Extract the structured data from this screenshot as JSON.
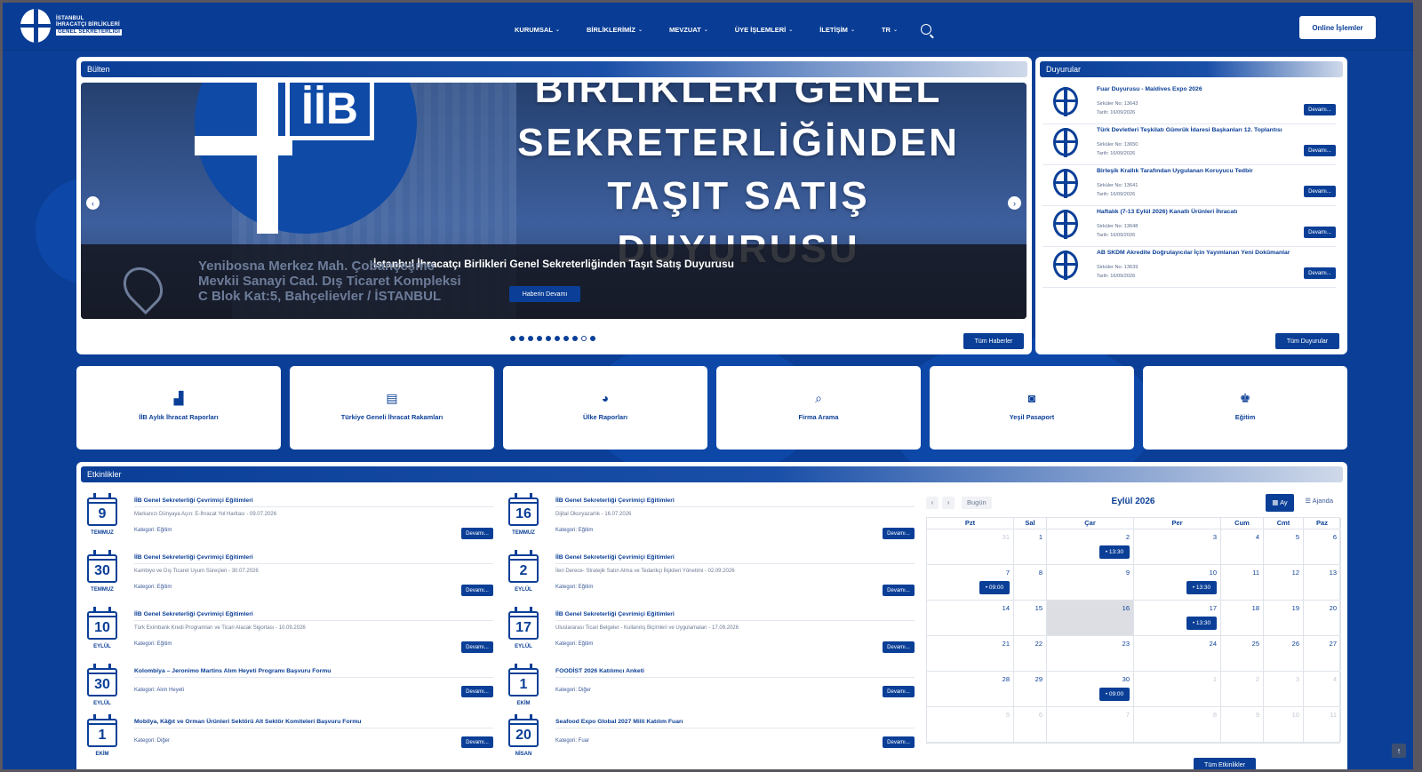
{
  "header": {
    "logo_lines": [
      "İSTANBUL",
      "İHRACATÇI BİRLİKLERİ",
      "GENEL SEKRETERLİĞİ"
    ],
    "nav": [
      {
        "label": "KURUMSAL"
      },
      {
        "label": "BİRLİKLERİMİZ"
      },
      {
        "label": "MEVZUAT"
      },
      {
        "label": "ÜYE İŞLEMLERİ"
      },
      {
        "label": "İLETİŞİM"
      },
      {
        "label": "TR"
      }
    ],
    "chevron": "⌄",
    "online_button": "Online İşlemler"
  },
  "bulten": {
    "title": "Bülten",
    "slide_text_lines": [
      "BİRLİKLERİ GENEL",
      "SEKRETERLİĞİNDEN",
      "TAŞIT SATIŞ",
      "DUYURUSU"
    ],
    "slide_logo": "İİB",
    "slide_address_lines": [
      "Yenibosna Merkez Mah. Çobançeşme",
      "Mevkii Sanayi Cad. Dış Ticaret Kompleksi",
      "C Blok Kat:5, Bahçelievler / İSTANBUL"
    ],
    "caption": "İstanbul İhracatçı Birlikleri Genel Sekreterliğinden Taşıt Satış Duyurusu",
    "caption_button": "Haberin Devamı",
    "all_button": "Tüm Haberler",
    "dots_total": 10,
    "dots_active_index": 8,
    "prev_arrow": "‹",
    "next_arrow": "›"
  },
  "duyurular": {
    "title": "Duyurular",
    "items": [
      {
        "title": "Fuar Duyurusu - Maldives Expo 2026",
        "no": "Sirküler No: 13643",
        "date": "Tarih: 16/09/2026",
        "button": "Devamı..."
      },
      {
        "title": "Türk Devletleri Teşkilatı Gümrük İdaresi Başkanları 12. Toplantısı",
        "no": "Sirküler No: 13650",
        "date": "Tarih: 16/09/2026",
        "button": "Devamı..."
      },
      {
        "title": "Birleşik Krallık Tarafından Uygulanan Koruyucu Tedbir",
        "no": "Sirküler No: 13641",
        "date": "Tarih: 16/09/2026",
        "button": "Devamı..."
      },
      {
        "title": "Haftalık (7-13 Eylül 2026) Kanatlı Ürünleri İhracatı",
        "no": "Sirküler No: 13648",
        "date": "Tarih: 16/09/2026",
        "button": "Devamı..."
      },
      {
        "title": "AB SKDM Akredite Doğrulayıcılar İçin Yayımlanan Yeni Dokümanlar",
        "no": "Sirküler No: 13639",
        "date": "Tarih: 16/09/2026",
        "button": "Devamı..."
      }
    ],
    "all_button": "Tüm Duyurular"
  },
  "tiles": [
    {
      "icon": "▟",
      "label": "İİB Aylık İhracat Raporları"
    },
    {
      "icon": "▤",
      "label": "Türkiye Geneli İhracat Rakamları"
    },
    {
      "icon": "◕",
      "label": "Ülke Raporları"
    },
    {
      "icon": "⌕",
      "label": "Firma Arama"
    },
    {
      "icon": "◙",
      "label": "Yeşil Pasaport"
    },
    {
      "icon": "♚",
      "label": "Eğitim"
    }
  ],
  "etkinlikler": {
    "title": "Etkinlikler",
    "left": [
      {
        "day": "9",
        "month": "TEMMUZ",
        "title": "İİB Genel Sekreterliği Çevrimiçi Eğitimleri",
        "sub": "Markanızı Dünyaya Açın: E-İhracat Yol Haritası - 09.07.2026",
        "cat": "Kategori: Eğitim",
        "button": "Devamı..."
      },
      {
        "day": "30",
        "month": "TEMMUZ",
        "title": "İİB Genel Sekreterliği Çevrimiçi Eğitimleri",
        "sub": "Kambiyo ve Dış Ticaret Uyum Süreçleri - 30.07.2026",
        "cat": "Kategori: Eğitim",
        "button": "Devamı..."
      },
      {
        "day": "10",
        "month": "EYLÜL",
        "title": "İİB Genel Sekreterliği Çevrimiçi Eğitimleri",
        "sub": "Türk Eximbank Kredi Programları ve Ticari Alacak Sigortası - 10.09.2026",
        "cat": "Kategori: Eğitim",
        "button": "Devamı..."
      },
      {
        "day": "30",
        "month": "EYLÜL",
        "title": "Kolombiya – Jeronimo Martins Alım Heyeti Programı Başvuru Formu",
        "sub": "",
        "cat": "Kategori: Alım Heyeti",
        "button": "Devamı..."
      },
      {
        "day": "1",
        "month": "EKİM",
        "title": "Mobilya, Kâğıt ve Orman Ürünleri Sektörü Alt Sektör Komiteleri Başvuru Formu",
        "sub": "",
        "cat": "Kategori: Diğer",
        "button": "Devamı..."
      }
    ],
    "right": [
      {
        "day": "16",
        "month": "TEMMUZ",
        "title": "İİB Genel Sekreterliği Çevrimiçi Eğitimleri",
        "sub": "Dijital Okuryazarlık - 16.07.2026",
        "cat": "Kategori: Eğitim",
        "button": "Devamı..."
      },
      {
        "day": "2",
        "month": "EYLÜL",
        "title": "İİB Genel Sekreterliği Çevrimiçi Eğitimleri",
        "sub": "İleri Derece- Stratejik Satın Alma ve Tedarikçi İlişkileri Yönetimi - 02.09.2026",
        "cat": "Kategori: Eğitim",
        "button": "Devamı..."
      },
      {
        "day": "17",
        "month": "EYLÜL",
        "title": "İİB Genel Sekreterliği Çevrimiçi Eğitimleri",
        "sub": "Uluslararası Ticari Belgeler - Kullanılış Biçimleri ve Uygulamaları - 17.09.2026",
        "cat": "Kategori: Eğitim",
        "button": "Devamı..."
      },
      {
        "day": "1",
        "month": "EKİM",
        "title": "FOODİST 2026 Katılımcı Anketi",
        "sub": "",
        "cat": "Kategori: Diğer",
        "button": "Devamı..."
      },
      {
        "day": "20",
        "month": "NİSAN",
        "title": "Seafood Expo Global 2027 Milli Katılım Fuarı",
        "sub": "",
        "cat": "Kategori: Fuar",
        "button": "Devamı..."
      }
    ],
    "all_button": "Tüm Etkinlikler"
  },
  "calendar": {
    "prev": "‹",
    "next": "›",
    "today_button": "Bugün",
    "title": "Eylül 2026",
    "view_month": "Ay",
    "view_agenda": "Ajanda",
    "weekdays": [
      "Pzt",
      "Sal",
      "Çar",
      "Per",
      "Cum",
      "Cmt",
      "Paz"
    ],
    "weeks": [
      [
        {
          "n": "31",
          "muted": true
        },
        {
          "n": "1"
        },
        {
          "n": "2",
          "event": "• 13:30"
        },
        {
          "n": "3"
        },
        {
          "n": "4"
        },
        {
          "n": "5"
        },
        {
          "n": "6"
        }
      ],
      [
        {
          "n": "7",
          "event": "• 09:00"
        },
        {
          "n": "8"
        },
        {
          "n": "9"
        },
        {
          "n": "10",
          "event": "• 13:30"
        },
        {
          "n": "11"
        },
        {
          "n": "12"
        },
        {
          "n": "13"
        }
      ],
      [
        {
          "n": "14"
        },
        {
          "n": "15"
        },
        {
          "n": "16",
          "today": true
        },
        {
          "n": "17",
          "event": "• 13:30"
        },
        {
          "n": "18"
        },
        {
          "n": "19"
        },
        {
          "n": "20"
        }
      ],
      [
        {
          "n": "21"
        },
        {
          "n": "22"
        },
        {
          "n": "23"
        },
        {
          "n": "24"
        },
        {
          "n": "25"
        },
        {
          "n": "26"
        },
        {
          "n": "27"
        }
      ],
      [
        {
          "n": "28"
        },
        {
          "n": "29"
        },
        {
          "n": "30",
          "event": "• 09:00"
        },
        {
          "n": "1",
          "muted": true
        },
        {
          "n": "2",
          "muted": true
        },
        {
          "n": "3",
          "muted": true
        },
        {
          "n": "4",
          "muted": true
        }
      ],
      [
        {
          "n": "5",
          "muted": true
        },
        {
          "n": "6",
          "muted": true
        },
        {
          "n": "7",
          "muted": true
        },
        {
          "n": "8",
          "muted": true
        },
        {
          "n": "9",
          "muted": true
        },
        {
          "n": "10",
          "muted": true
        },
        {
          "n": "11",
          "muted": true
        }
      ]
    ]
  },
  "scroll_top": "↑",
  "colors": {
    "brand": "#0b3f97",
    "background": "#0b3f97"
  }
}
